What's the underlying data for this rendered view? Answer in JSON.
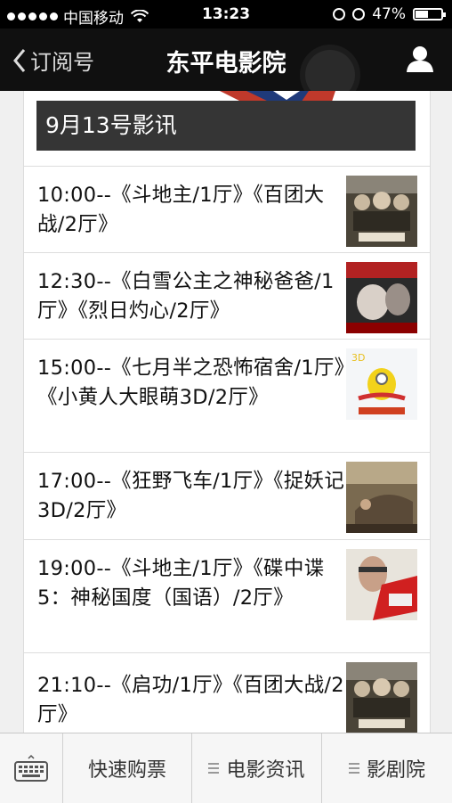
{
  "status_bar": {
    "carrier": "中国移动",
    "time": "13:23",
    "battery": "47%",
    "battery_level": 0.47
  },
  "nav": {
    "back_label": "订阅号",
    "title": "东平电影院"
  },
  "article": {
    "date_header": "9月13号影讯",
    "showtimes": [
      {
        "text": "10:00--《斗地主/1厅》《百团大战/2厅》",
        "poster": "war-poster"
      },
      {
        "text": "12:30--《白雪公主之神秘爸爸/1厅》《烈日灼心/2厅》",
        "poster": "red-poster"
      },
      {
        "text": "15:00--《七月半之恐怖宿舍/1厅》《小黄人大眼萌3D/2厅》",
        "poster": "minions-poster"
      },
      {
        "text": "17:00--《狂野飞车/1厅》《捉妖记3D/2厅》",
        "poster": "monster-poster"
      },
      {
        "text": "19:00--《斗地主/1厅》《碟中谍5：神秘国度（国语）/2厅》",
        "poster": "spy-poster"
      },
      {
        "text": "21:10--《启功/1厅》《百团大战/2厅》",
        "poster": "war-poster"
      }
    ]
  },
  "tabbar": {
    "keyboard_icon": "keyboard-icon",
    "tab1": "快速购票",
    "tab2": "电影资讯",
    "tab3": "影剧院"
  },
  "colors": {
    "nav_bg": "#101010",
    "header_bg": "#353535",
    "tabbar_bg": "#f6f6f6"
  }
}
